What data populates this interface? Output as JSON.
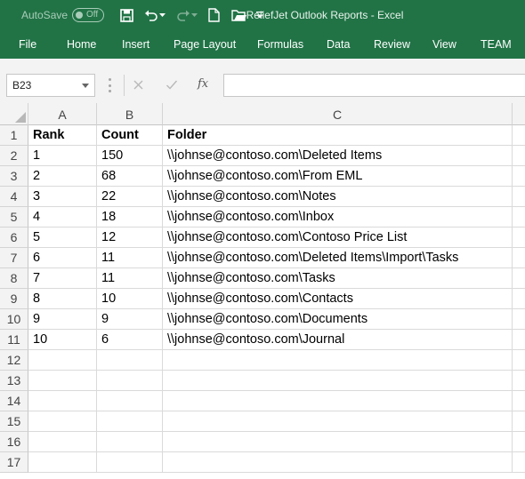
{
  "titlebar": {
    "autosave_label": "AutoSave",
    "autosave_state": "Off",
    "title": "ReliefJet Outlook Reports  -  Excel"
  },
  "ribbon": {
    "tabs": [
      "File",
      "Home",
      "Insert",
      "Page Layout",
      "Formulas",
      "Data",
      "Review",
      "View",
      "TEAM"
    ]
  },
  "formula_bar": {
    "name_box": "B23",
    "fx_label": "fx",
    "value": ""
  },
  "sheet": {
    "columns": [
      "A",
      "B",
      "C"
    ],
    "row_numbers": [
      "1",
      "2",
      "3",
      "4",
      "5",
      "6",
      "7",
      "8",
      "9",
      "10",
      "11",
      "12",
      "13",
      "14",
      "15",
      "16",
      "17"
    ],
    "header": [
      "Rank",
      "Count",
      "Folder"
    ],
    "rows": [
      [
        "1",
        "150",
        "\\\\johnse@contoso.com\\Deleted Items"
      ],
      [
        "2",
        "68",
        "\\\\johnse@contoso.com\\From EML"
      ],
      [
        "3",
        "22",
        "\\\\johnse@contoso.com\\Notes"
      ],
      [
        "4",
        "18",
        "\\\\johnse@contoso.com\\Inbox"
      ],
      [
        "5",
        "12",
        "\\\\johnse@contoso.com\\Contoso Price List"
      ],
      [
        "6",
        "11",
        "\\\\johnse@contoso.com\\Deleted Items\\Import\\Tasks"
      ],
      [
        "7",
        "11",
        "\\\\johnse@contoso.com\\Tasks"
      ],
      [
        "8",
        "10",
        "\\\\johnse@contoso.com\\Contacts"
      ],
      [
        "9",
        "9",
        "\\\\johnse@contoso.com\\Documents"
      ],
      [
        "10",
        "6",
        "\\\\johnse@contoso.com\\Journal"
      ]
    ]
  },
  "colors": {
    "brand": "#217346",
    "header_bg": "#f3f3f3",
    "gridline": "#dadada"
  },
  "icons": [
    "save-icon",
    "undo-icon",
    "redo-icon",
    "new-file-icon",
    "open-folder-icon",
    "customize-qat-icon",
    "cancel-icon",
    "enter-icon"
  ]
}
